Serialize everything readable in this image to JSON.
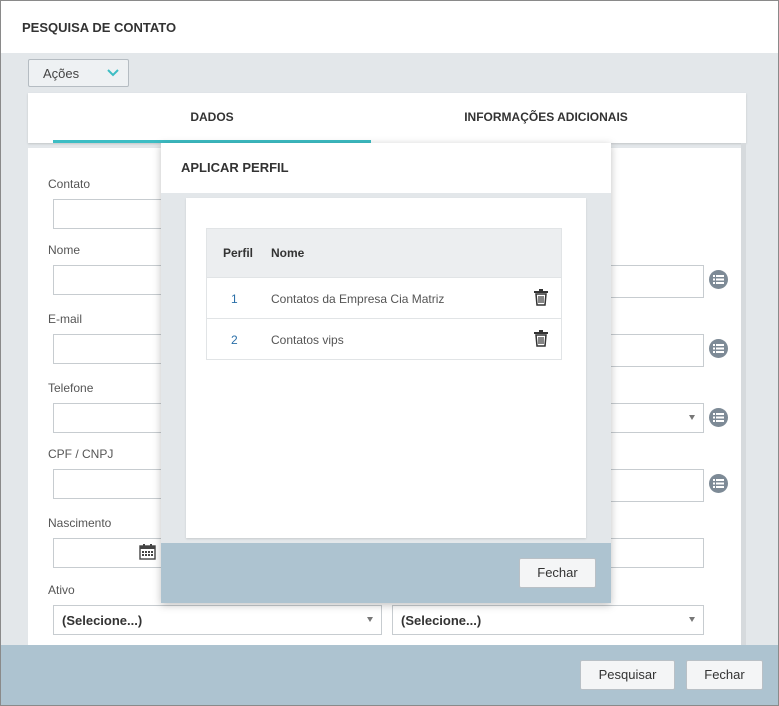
{
  "window": {
    "title": "PESQUISA DE CONTATO"
  },
  "actions": {
    "label": "Ações"
  },
  "tabs": [
    {
      "label": "DADOS",
      "active": true
    },
    {
      "label": "INFORMAÇÕES ADICIONAIS",
      "active": false
    }
  ],
  "form": {
    "contato_label": "Contato",
    "nome_label": "Nome",
    "email_label": "E-mail",
    "telefone_label": "Telefone",
    "cpf_label": "CPF / CNPJ",
    "nascimento_label": "Nascimento",
    "ativo_label": "Ativo",
    "ativo_value_1": "(Selecione...)",
    "ativo_value_2": "(Selecione...)"
  },
  "modal": {
    "title": "APLICAR PERFIL",
    "columns": {
      "perfil": "Perfil",
      "nome": "Nome"
    },
    "rows": [
      {
        "perfil": "1",
        "nome": "Contatos da Empresa Cia Matriz"
      },
      {
        "perfil": "2",
        "nome": "Contatos vips"
      }
    ],
    "close_label": "Fechar"
  },
  "footer": {
    "search_label": "Pesquisar",
    "close_label": "Fechar"
  },
  "colors": {
    "accent": "#3dbdc4",
    "footer_bg": "#adc3d0",
    "panel_bg": "#e3e7ea"
  }
}
